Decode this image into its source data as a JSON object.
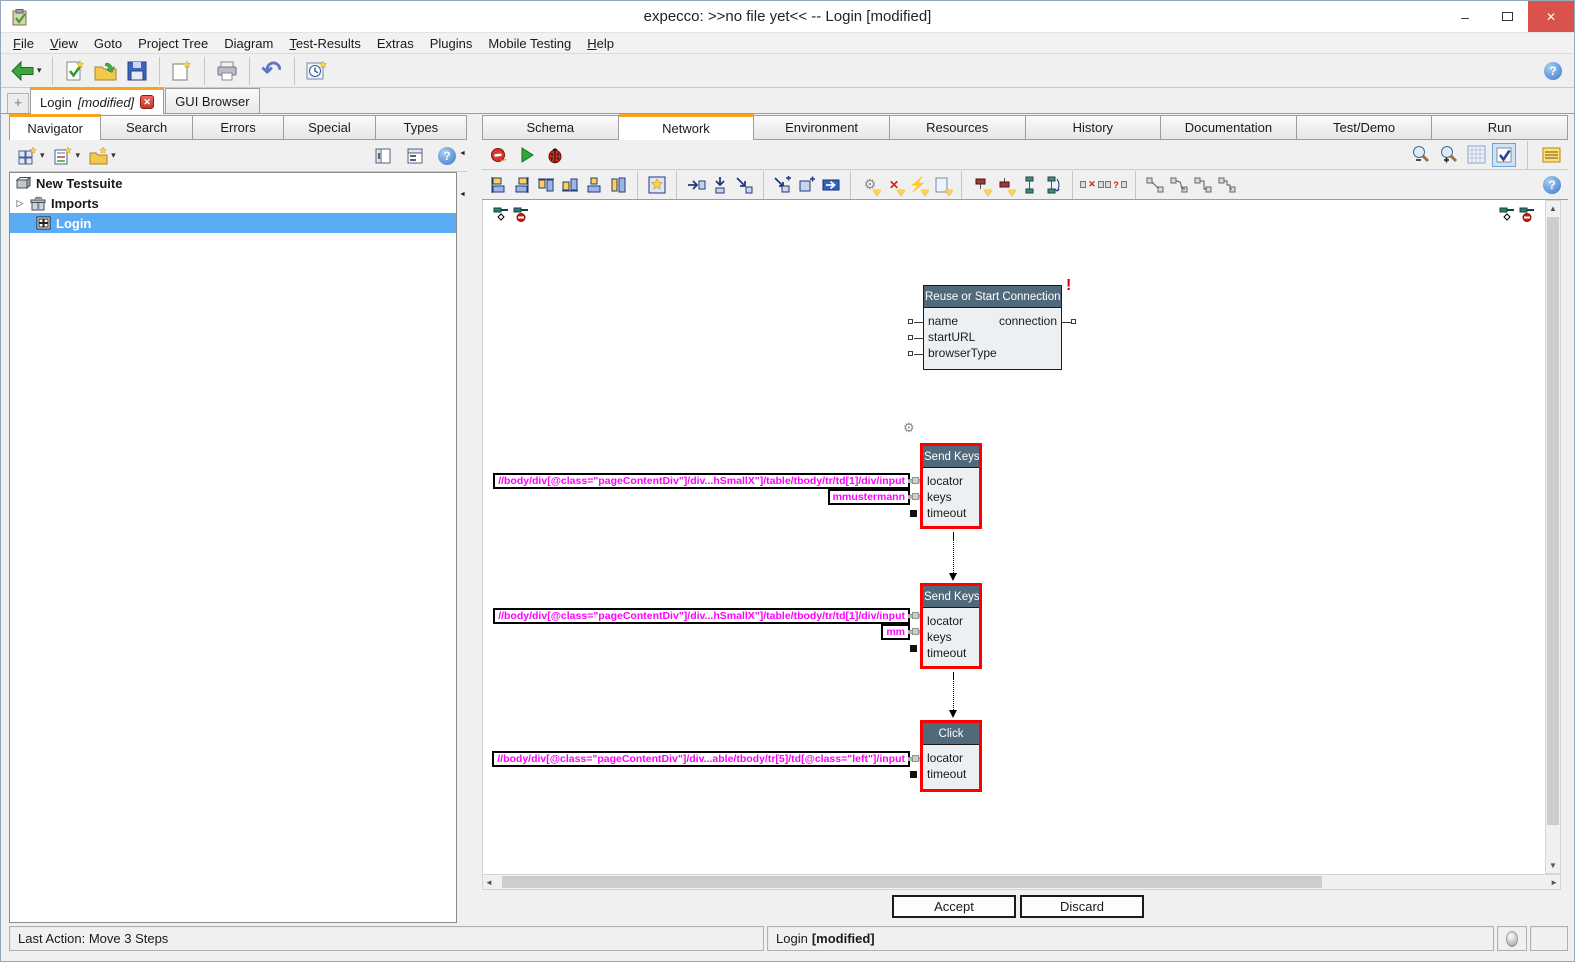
{
  "window": {
    "title": "expecco: >>no file yet<< -- Login [modified]"
  },
  "icons": {
    "chevron_down": "▾",
    "plus": "+",
    "close": "✕",
    "minimize": "–",
    "undo": "↶",
    "question": "?",
    "gear": "⚙",
    "lightning": "⚡",
    "expand": "▷",
    "up_arrow": "▲",
    "down_arrow": "▼",
    "left_arrow": "◄",
    "right_arrow": "►",
    "splitter_left": "◄"
  },
  "menubar": {
    "items": [
      "File",
      "View",
      "Goto",
      "Project Tree",
      "Diagram",
      "Test-Results",
      "Extras",
      "Plugins",
      "Mobile Testing",
      "Help"
    ]
  },
  "doc_tabs": {
    "tab1_name": "Login",
    "tab1_suffix": "[modified]",
    "tab2_name": "GUI Browser"
  },
  "left_panel": {
    "tabs": [
      "Navigator",
      "Search",
      "Errors",
      "Special",
      "Types"
    ],
    "tree": [
      {
        "label": "New Testsuite"
      },
      {
        "label": "Imports"
      },
      {
        "label": "Login"
      }
    ]
  },
  "right_panel": {
    "tabs": [
      "Schema",
      "Network",
      "Environment",
      "Resources",
      "History",
      "Documentation",
      "Test/Demo",
      "Run"
    ]
  },
  "diagram": {
    "blocks": [
      {
        "title": "Reuse or Start Connection",
        "inputs": [
          "name",
          "startURL",
          "browserType"
        ],
        "output": "connection",
        "error_marker": "!"
      },
      {
        "title": "Send Keys",
        "inputs": [
          "locator",
          "keys",
          "timeout"
        ]
      },
      {
        "title": "Send Keys",
        "inputs": [
          "locator",
          "keys",
          "timeout"
        ]
      },
      {
        "title": "Click",
        "inputs": [
          "locator",
          "timeout"
        ]
      }
    ],
    "labels": {
      "xpath_user_field": "//body/div[@class=\"pageContentDiv\"]/div...hSmallX\"]/table/tbody/tr/td[1]/div/input",
      "user_value": "mmustermann",
      "xpath_pass_field": "//body/div[@class=\"pageContentDiv\"]/div...hSmallX\"]/table/tbody/tr/td[1]/div/input",
      "pass_value": "mm",
      "xpath_login_button": "//body/div[@class=\"pageContentDiv\"]/div...able/tbody/tr[5]/td[@class=\"left\"]/input"
    }
  },
  "footer": {
    "accept": "Accept",
    "discard": "Discard"
  },
  "statusbar": {
    "last_action": "Last Action: Move 3 Steps",
    "doc_name": "Login",
    "doc_suffix": "[modified]"
  },
  "colors": {
    "accent_orange": "#f7a420",
    "selection_blue": "#5cabf5",
    "block_header": "#50697b",
    "block_body": "#edf0f2",
    "selected_block_border": "#ff0000",
    "xpath_text": "#ff00ff",
    "close_button_red": "#d9534a",
    "error_red": "#dd0000"
  }
}
